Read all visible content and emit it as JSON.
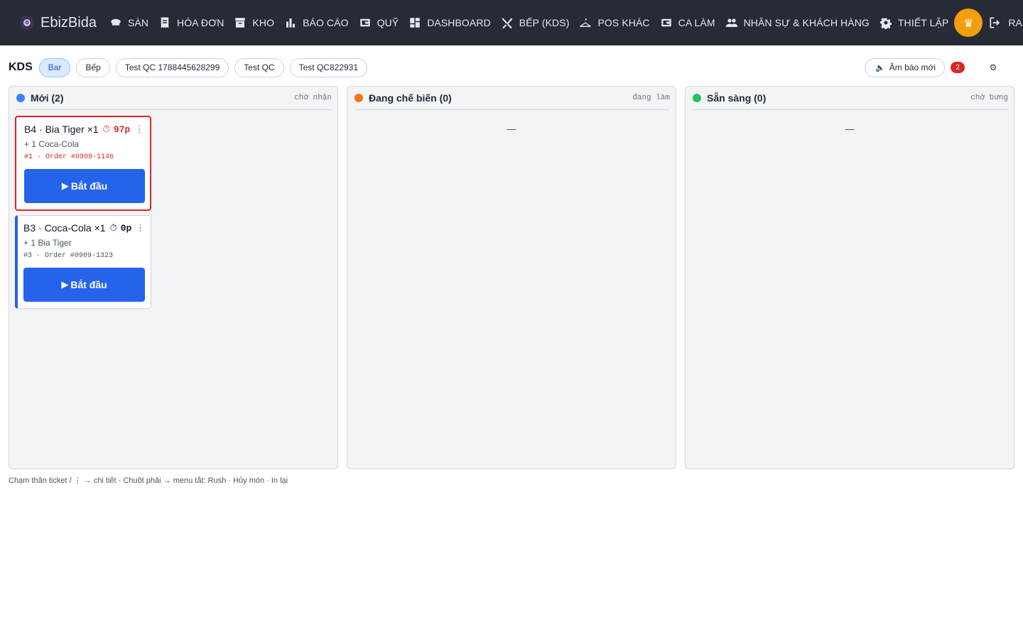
{
  "brand": {
    "name": "EbizBida",
    "logo_char": "0"
  },
  "nav": {
    "items": [
      {
        "label": "SÀN",
        "icon": "pool-icon"
      },
      {
        "label": "HÓA ĐƠN",
        "icon": "receipt-icon"
      },
      {
        "label": "KHO",
        "icon": "archive-icon"
      },
      {
        "label": "BÁO CÁO",
        "icon": "bar-chart-icon"
      },
      {
        "label": "QUỸ",
        "icon": "wallet-icon"
      },
      {
        "label": "DASHBOARD",
        "icon": "dashboard-icon"
      },
      {
        "label": "BẾP (KDS)",
        "icon": "utensils-icon"
      },
      {
        "label": "POS KHÁC",
        "icon": "hanger-icon"
      },
      {
        "label": "CA LÀM",
        "icon": "wallet-icon"
      },
      {
        "label": "NHÂN SỰ & KHÁCH HÀNG",
        "icon": "people-icon"
      },
      {
        "label": "THIẾT LẬP",
        "icon": "gear-icon"
      }
    ],
    "avatar_glyph": "♛",
    "logout_label": "RA"
  },
  "toolbar": {
    "title": "KDS",
    "stations": [
      "Bar",
      "Bếp",
      "Test QC 1788445628299",
      "Test QC",
      "Test QC822931"
    ],
    "active_station": "Bar",
    "sound_label": "Âm báo mới",
    "sound_icon": "speaker-icon",
    "badge_count": "2",
    "settings_glyph": "⚙"
  },
  "columns": [
    {
      "title": "Mới (2)",
      "subtitle": "chờ nhận",
      "color": "#3b82f6"
    },
    {
      "title": "Đang chế biến (0)",
      "subtitle": "đang làm",
      "color": "#f97316",
      "empty": "—"
    },
    {
      "title": "Sẵn sàng (0)",
      "subtitle": "chờ bưng",
      "color": "#22c55e",
      "empty": "—"
    }
  ],
  "tickets": [
    {
      "title": "B4 · Bia Tiger ×1",
      "timer": "97p",
      "modifier": "+ 1 Coca-Cola",
      "order": "#1 · Order #0909-1146",
      "action": "Bắt đầu",
      "late": true
    },
    {
      "title": "B3 · Coca-Cola ×1",
      "timer": "0p",
      "modifier": "+ 1 Bia Tiger",
      "order": "#3 · Order #0909-1323",
      "action": "Bắt đầu",
      "late": false
    }
  ],
  "icons": {
    "timer": "⏱",
    "more": "⋮",
    "play": "▶"
  },
  "hint": "Chạm thân ticket / ⋮ → chi tiết · Chuột phải → menu tắt: Rush · Hủy món · In lại"
}
